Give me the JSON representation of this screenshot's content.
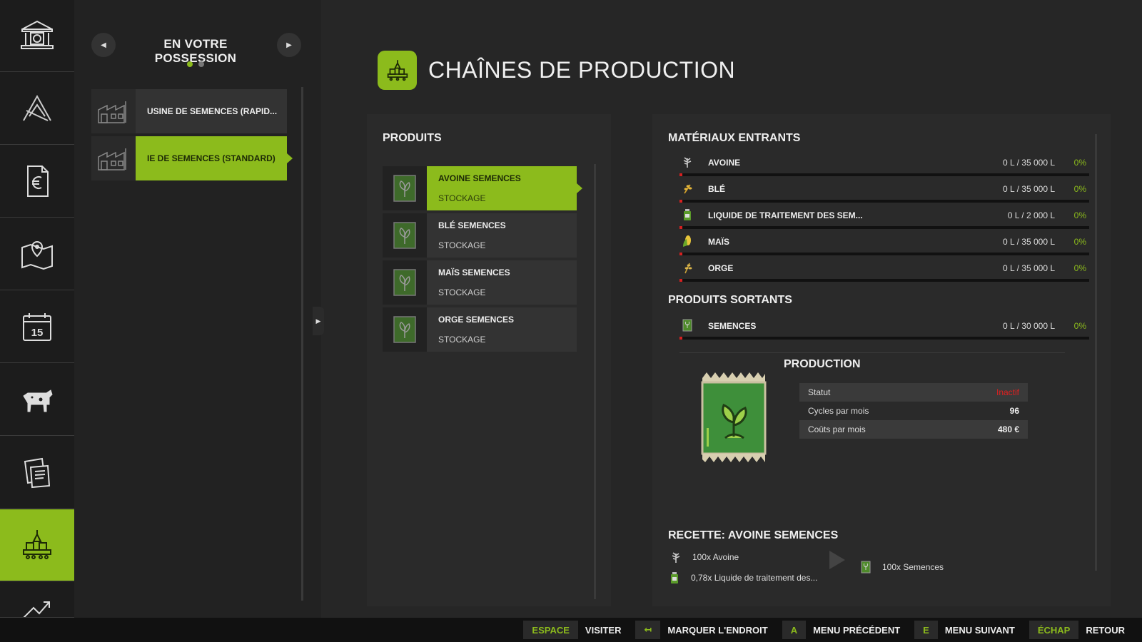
{
  "colors": {
    "accent": "#8cbb1c",
    "inactive": "#e02020",
    "background": "#262626",
    "panel": "#2a2a2a"
  },
  "rail": {
    "items": [
      {
        "icon": "bank-icon"
      },
      {
        "icon": "logo-icon"
      },
      {
        "icon": "euro-document-icon"
      },
      {
        "icon": "map-pin-icon"
      },
      {
        "icon": "calendar-icon",
        "value": "15"
      },
      {
        "icon": "cow-icon"
      },
      {
        "icon": "contracts-icon"
      },
      {
        "icon": "production-icon",
        "active": true
      },
      {
        "icon": "chart-icon"
      }
    ]
  },
  "owned": {
    "title": "EN VOTRE POSSESSION",
    "pages": 2,
    "current_page": 1,
    "items": [
      {
        "label": "USINE DE SEMENCES (RAPID..."
      },
      {
        "label": "IE DE SEMENCES (STANDARD)",
        "active": true
      }
    ]
  },
  "header": {
    "title": "CHAÎNES DE PRODUCTION",
    "icon": "production-icon"
  },
  "products": {
    "title": "PRODUITS",
    "items": [
      {
        "name": "AVOINE SEMENCES",
        "sub": "STOCKAGE",
        "icon": "seed-bag-icon",
        "active": true
      },
      {
        "name": "BLÉ SEMENCES",
        "sub": "STOCKAGE",
        "icon": "seed-bag-icon"
      },
      {
        "name": "MAÏS SEMENCES",
        "sub": "STOCKAGE",
        "icon": "seed-bag-icon"
      },
      {
        "name": "ORGE SEMENCES",
        "sub": "STOCKAGE",
        "icon": "seed-bag-icon"
      }
    ]
  },
  "inputs": {
    "title": "MATÉRIAUX ENTRANTS",
    "items": [
      {
        "name": "AVOINE",
        "amount": "0 L / 35 000 L",
        "percent": "0%",
        "fill": 0,
        "icon": "oat-icon"
      },
      {
        "name": "BLÉ",
        "amount": "0 L / 35 000 L",
        "percent": "0%",
        "fill": 0,
        "icon": "wheat-icon"
      },
      {
        "name": "LIQUIDE DE TRAITEMENT DES SEM...",
        "amount": "0 L / 2 000 L",
        "percent": "0%",
        "fill": 0,
        "icon": "bottle-icon"
      },
      {
        "name": "MAÏS",
        "amount": "0 L / 35 000 L",
        "percent": "0%",
        "fill": 0,
        "icon": "corn-icon"
      },
      {
        "name": "ORGE",
        "amount": "0 L / 35 000 L",
        "percent": "0%",
        "fill": 0,
        "icon": "barley-icon"
      }
    ]
  },
  "outputs": {
    "title": "PRODUITS SORTANTS",
    "items": [
      {
        "name": "SEMENCES",
        "amount": "0 L / 30 000 L",
        "percent": "0%",
        "fill": 0,
        "icon": "seeds-icon"
      }
    ]
  },
  "production": {
    "title": "PRODUCTION",
    "rows": [
      {
        "key": "Statut",
        "value": "Inactif"
      },
      {
        "key": "Cycles par mois",
        "value": "96"
      },
      {
        "key": "Coûts par mois",
        "value": "480 €"
      }
    ]
  },
  "recipe": {
    "title": "RECETTE: AVOINE SEMENCES",
    "inputs": [
      {
        "text": "100x Avoine",
        "icon": "oat-icon"
      },
      {
        "text": "0,78x Liquide de traitement des...",
        "icon": "bottle-icon"
      }
    ],
    "output": {
      "text": "100x Semences",
      "icon": "seeds-icon"
    }
  },
  "bottom_bar": {
    "hints": [
      {
        "key": "ESPACE",
        "label": "VISITER"
      },
      {
        "key": "↤",
        "label": "MARQUER L'ENDROIT"
      },
      {
        "key": "A",
        "label": "MENU PRÉCÉDENT"
      },
      {
        "key": "E",
        "label": "MENU SUIVANT"
      },
      {
        "key": "ÉCHAP",
        "label": "RETOUR"
      }
    ]
  }
}
